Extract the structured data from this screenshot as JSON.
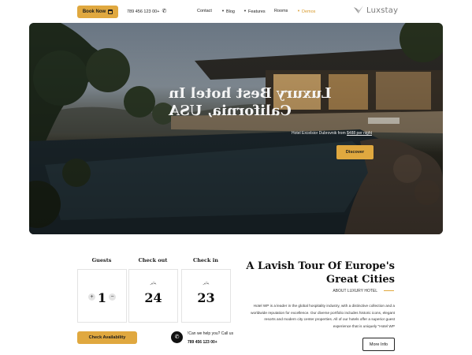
{
  "header": {
    "book_now_label": "Book Now",
    "phone": "789 456 123 00+",
    "nav": [
      {
        "label": "Contact",
        "has_caret": false
      },
      {
        "label": "Blog",
        "has_caret": true
      },
      {
        "label": "Features",
        "has_caret": true
      },
      {
        "label": "Rooms",
        "has_caret": false
      },
      {
        "label": "Demos",
        "has_caret": true,
        "active": true
      }
    ],
    "logo_text": "Luxstay"
  },
  "hero": {
    "title": "Luxury Best hotel In California, USA",
    "subtitle_prefix": "Hotel Excelsior Dubrovnik from",
    "price": "$488 per night",
    "discover_label": "Discover"
  },
  "booking": {
    "guests_label": "Guests",
    "checkout_label": "Check out",
    "checkin_label": "Check in",
    "guests_value": "1",
    "checkout_small": "يناير",
    "checkout_value": "24",
    "checkin_small": "يناير",
    "checkin_value": "23",
    "plus": "+",
    "minus": "−",
    "check_availability_label": "Check Availability",
    "help_text": "!Can we help you? Call us",
    "help_number": "789 456 123 00+"
  },
  "promo": {
    "title": "A Lavish Tour Of Europe's Great Cities",
    "tag": "ABOUT LUXURY HOTEL",
    "body": "Hotel WP is a leader in the global hospitality industry, with a distinctive collection and a worldwide reputation for excellence. Our diverse portfolio includes historic icons, elegant resorts and modern city center properties. All of our hotels offer a superior guest experience that is uniquely \"Hotel WP",
    "more_label": "More Info"
  },
  "colors": {
    "accent": "#e0a83f",
    "dark": "#1b1b1b"
  }
}
